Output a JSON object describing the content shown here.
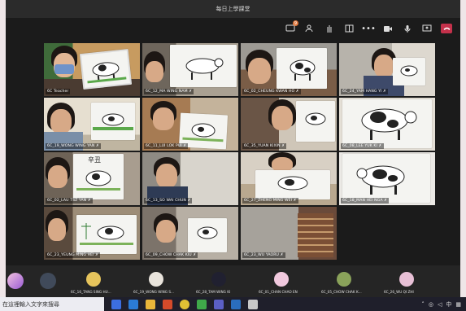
{
  "window": {
    "title": "每日上學課堂"
  },
  "toolbar": {
    "chat_badge": "9",
    "icons": [
      "chat-icon",
      "people-icon",
      "raise-hand-icon",
      "rooms-icon",
      "more-icon",
      "camera-icon",
      "mic-icon",
      "share-icon",
      "leave-icon"
    ]
  },
  "participants": [
    {
      "name": "6C Teacher",
      "mic": ""
    },
    {
      "name": "6C_12_MA WING NAM",
      "mic": "✗"
    },
    {
      "name": "6C_02_CHEUNG KWAN HO",
      "mic": "✗"
    },
    {
      "name": "6C_24_YAM HANG YI",
      "mic": "✗"
    },
    {
      "name": "6C_19_WONG WING YAN",
      "mic": "✗"
    },
    {
      "name": "6C_11_LUI LOK PUI",
      "mic": "✗"
    },
    {
      "name": "6C_35_YUAN KIXIN",
      "mic": "✗"
    },
    {
      "name": "6C_08_LEE YUK KI",
      "mic": "✗"
    },
    {
      "name": "6C_02_LAU TSZ YAN",
      "mic": "✗"
    },
    {
      "name": "6C_13_SO WAI CHUN",
      "mic": "✗"
    },
    {
      "name": "6C_27_ZHENG MING WEI",
      "mic": "✗"
    },
    {
      "name": "6C_18_MAN HEI NGA",
      "mic": "✗"
    },
    {
      "name": "6C_23_YEUNG MING HEI",
      "mic": "✗"
    },
    {
      "name": "6C_09_CHOW CHAK KIU",
      "mic": "✗"
    },
    {
      "name": "6C_23_WU YAORU",
      "mic": "✗"
    }
  ],
  "strip": [
    {
      "name": "6C_16_TANG SING HU..."
    },
    {
      "name": "6C_19_WONG WING S..."
    },
    {
      "name": "6C_28_TAM WING KI"
    },
    {
      "name": "6C_01_CHAN CHAO EN"
    },
    {
      "name": "6C_05_CHOW CHAK K..."
    },
    {
      "name": "6C_26_WU QI ZHI"
    }
  ],
  "taskbar": {
    "search_placeholder": "在這裡輸入文字來搜尋",
    "input_indicator": "中"
  },
  "colors": {
    "leave": "#c4314b",
    "badge": "#e27a3f",
    "background": "#1b1b1b"
  }
}
